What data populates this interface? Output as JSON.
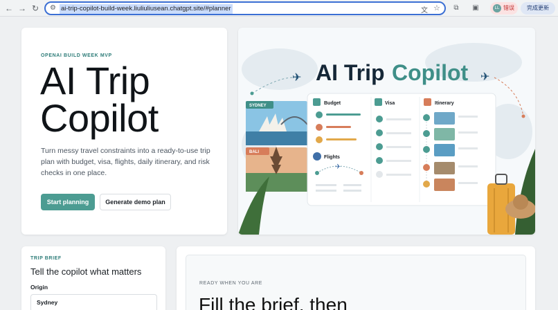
{
  "browser": {
    "url": "ai-trip-copilot-build-week.liuliuliusean.chatgpt.site/#planner",
    "profile_label": "错误",
    "profile_initials": "LL",
    "update_label": "完成更新"
  },
  "hero": {
    "eyebrow": "OPENAI BUILD WEEK MVP",
    "title": "AI Trip Copilot",
    "description": "Turn messy travel constraints into a ready-to-use trip plan with budget, visa, flights, daily itinerary, and risk checks in one place.",
    "primary_button": "Start planning",
    "secondary_button": "Generate demo plan"
  },
  "illustration": {
    "title_part1": "AI Trip",
    "title_part2": "Copilot",
    "photo1_label": "SYDNEY",
    "photo2_label": "BALI",
    "col_budget": "Budget",
    "col_visa": "Visa",
    "col_itinerary": "Itinerary",
    "flights_label": "Flights",
    "accent_color": "#3f8f88"
  },
  "brief": {
    "eyebrow": "TRIP BRIEF",
    "heading": "Tell the copilot what matters",
    "origin_label": "Origin",
    "origin_value": "Sydney"
  },
  "ready": {
    "eyebrow": "READY WHEN YOU ARE",
    "title": "Fill the brief, then"
  }
}
